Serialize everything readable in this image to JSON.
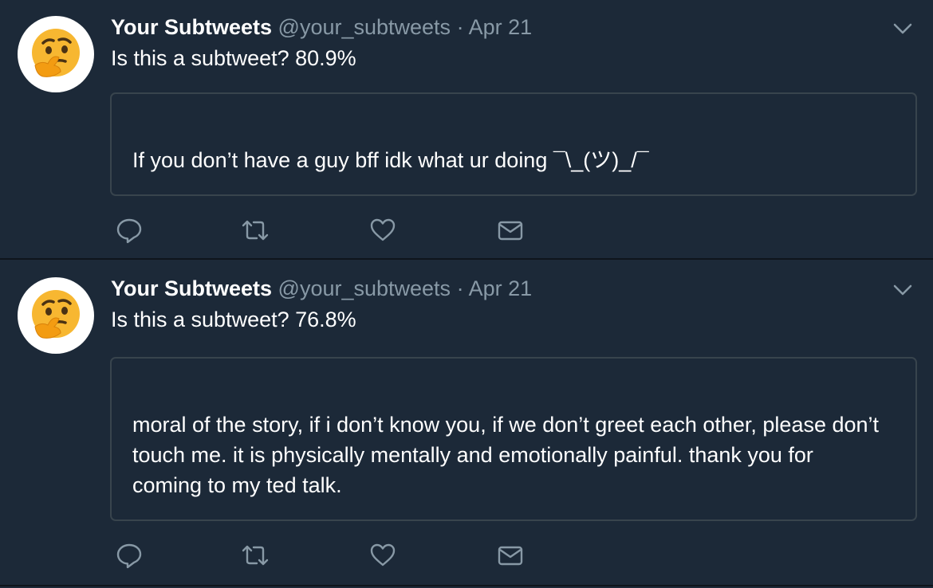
{
  "tweets": [
    {
      "author_name": "Your Subtweets",
      "handle": "@your_subtweets",
      "separator": "·",
      "date": "Apr 21",
      "status_text": "Is this a subtweet? 80.9%",
      "quote_text": "If you don’t have a guy bff idk what ur doing ¯\\_(ツ)_/¯",
      "avatar_icon": "thinking-face-emoji"
    },
    {
      "author_name": "Your Subtweets",
      "handle": "@your_subtweets",
      "separator": "·",
      "date": "Apr 21",
      "status_text": "Is this a subtweet? 76.8%",
      "quote_text": "moral of the story, if i don’t know you, if we don’t greet each other, please don’t touch me. it is physically mentally and emotionally painful. thank you for coming to my ted talk.",
      "avatar_icon": "thinking-face-emoji"
    }
  ],
  "icons": {
    "reply": "reply-icon",
    "retweet": "retweet-icon",
    "like": "heart-icon",
    "dm": "envelope-icon",
    "caret": "chevron-down-icon"
  },
  "colors": {
    "background": "#1c2938",
    "secondary_text": "#8899a6",
    "border": "#38444d",
    "icon": "#8899a6"
  }
}
